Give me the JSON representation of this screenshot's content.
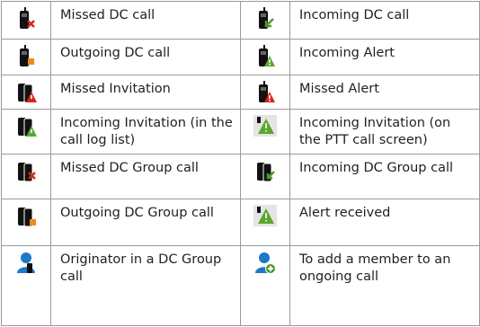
{
  "rows": [
    {
      "left": {
        "icon": "missed-dc-call-icon",
        "label": "Missed DC call"
      },
      "right": {
        "icon": "incoming-dc-call-icon",
        "label": "Incoming DC call"
      }
    },
    {
      "left": {
        "icon": "outgoing-dc-call-icon",
        "label": "Outgoing DC call"
      },
      "right": {
        "icon": "incoming-alert-icon",
        "label": "Incoming Alert"
      }
    },
    {
      "left": {
        "icon": "missed-invitation-icon",
        "label": "Missed Invitation"
      },
      "right": {
        "icon": "missed-alert-icon",
        "label": "Missed Alert"
      }
    },
    {
      "left": {
        "icon": "incoming-invitation-log-icon",
        "label": "Incoming Invitation (in the call log list)"
      },
      "right": {
        "icon": "incoming-invitation-ptt-icon",
        "label": "Incoming Invitation (on the PTT call screen)"
      }
    },
    {
      "left": {
        "icon": "missed-dc-group-call-icon",
        "label": "Missed DC Group call"
      },
      "right": {
        "icon": "incoming-dc-group-call-icon",
        "label": "Incoming DC Group call"
      }
    },
    {
      "left": {
        "icon": "outgoing-dc-group-call-icon",
        "label": "Outgoing DC Group call"
      },
      "right": {
        "icon": "alert-received-icon",
        "label": "Alert received"
      }
    },
    {
      "left": {
        "icon": "originator-icon",
        "label": "Originator in a DC Group call"
      },
      "right": {
        "icon": "add-member-icon",
        "label": "To add a member to an ongoing call"
      }
    }
  ],
  "colors": {
    "missed": "#d9241c",
    "incoming": "#4f9a2c",
    "outgoing": "#f08a1c",
    "alert": "#5aa62e",
    "person": "#1d78c8"
  }
}
